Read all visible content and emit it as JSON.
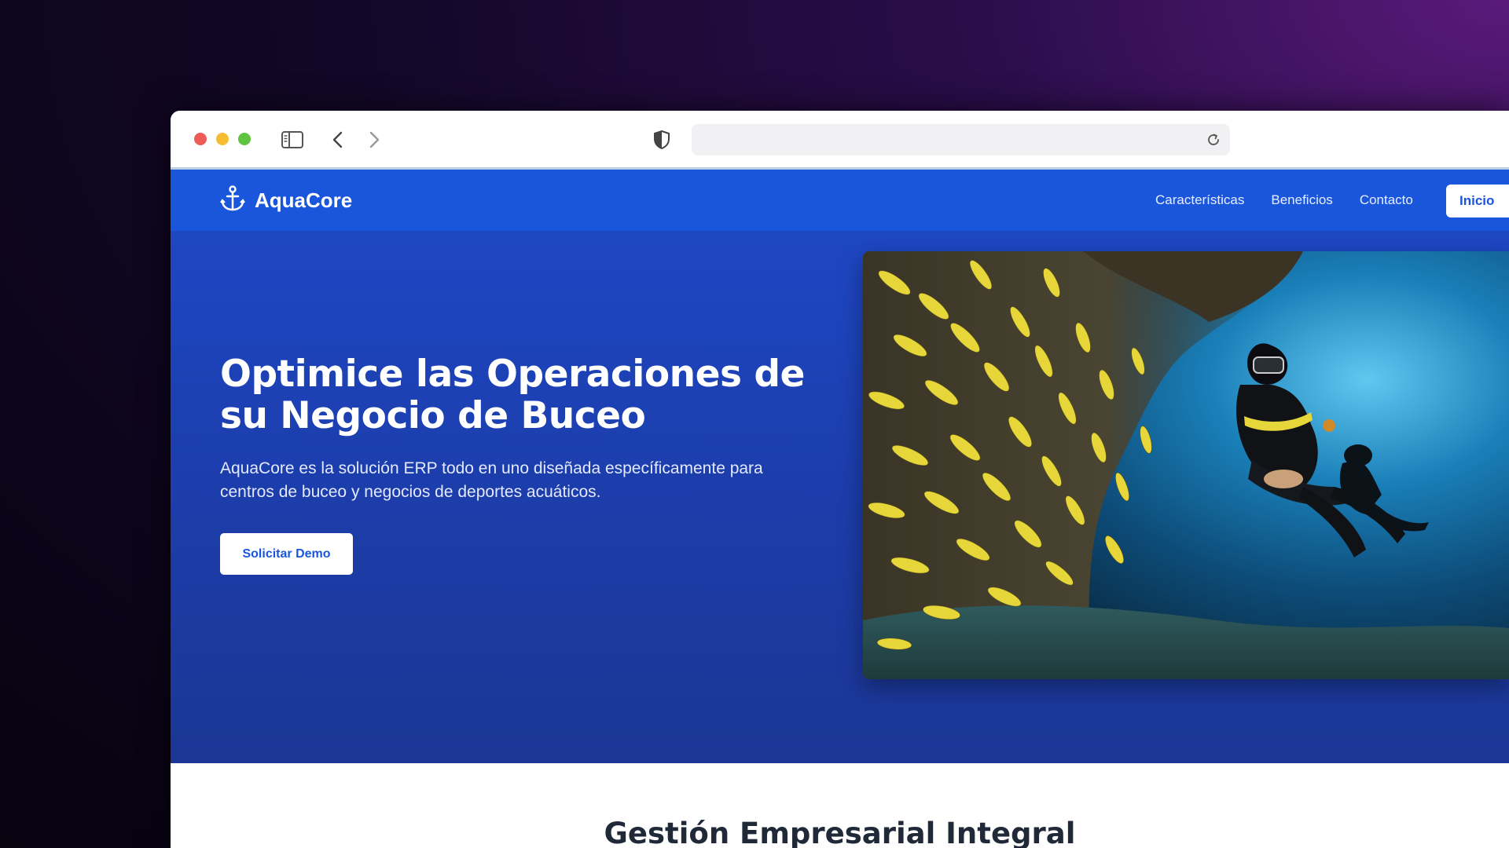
{
  "browser": {
    "url": "",
    "icons": [
      "sidebar-icon",
      "back-icon",
      "forward-icon",
      "shield-icon",
      "reload-icon"
    ]
  },
  "nav": {
    "brand": "AquaCore",
    "brand_icon": "anchor-icon",
    "links": [
      "Características",
      "Beneficios",
      "Contacto"
    ],
    "cta": "Inicio"
  },
  "hero": {
    "title": "Optimice las Operaciones de su Negocio de Buceo",
    "subtitle": "AquaCore es la solución ERP todo en uno diseñada específicamente para centros de buceo y negocios de deportes acuáticos.",
    "button": "Solicitar Demo",
    "image": "scuba-diver-with-yellow-fish-photo"
  },
  "section": {
    "title": "Gestión Empresarial Integral"
  },
  "colors": {
    "nav": "#1a56db",
    "hero": "#1c3ca8",
    "accent": "#1a56db"
  }
}
